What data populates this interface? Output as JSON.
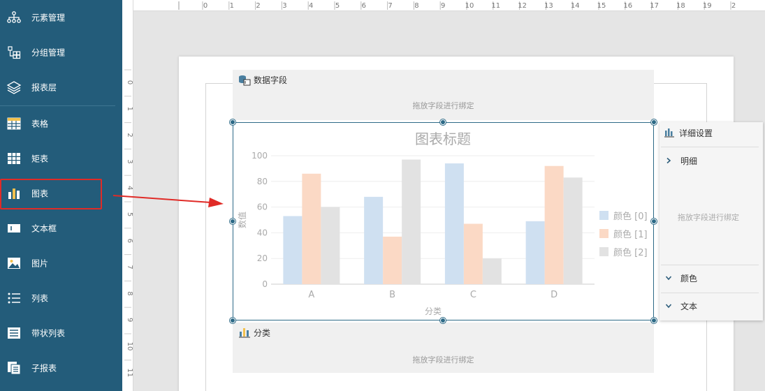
{
  "sidebar": {
    "items": [
      {
        "label": "元素管理",
        "icon": "hierarchy-icon"
      },
      {
        "label": "分组管理",
        "icon": "group-icon"
      },
      {
        "label": "报表层",
        "icon": "layers-icon"
      },
      {
        "label": "表格",
        "icon": "table-icon"
      },
      {
        "label": "矩表",
        "icon": "matrix-icon"
      },
      {
        "label": "图表",
        "icon": "chart-icon"
      },
      {
        "label": "文本框",
        "icon": "textbox-icon"
      },
      {
        "label": "图片",
        "icon": "image-icon"
      },
      {
        "label": "列表",
        "icon": "list-icon"
      },
      {
        "label": "带状列表",
        "icon": "banded-list-icon"
      },
      {
        "label": "子报表",
        "icon": "subreport-icon"
      }
    ],
    "highlighted": "图表",
    "highlight_color": "#e02b27"
  },
  "ruler": {
    "horizontal_labels": [
      "0",
      "1",
      "2",
      "3",
      "4",
      "5",
      "6",
      "7",
      "8",
      "9",
      "10",
      "11",
      "12",
      "13",
      "14",
      "15",
      "16",
      "17",
      "18",
      "19",
      "2"
    ],
    "vertical_labels": [
      "0",
      "1",
      "2",
      "3",
      "4",
      "5",
      "6",
      "7",
      "8",
      "9",
      "10",
      "11"
    ]
  },
  "zones": {
    "data_field": {
      "title": "数据字段",
      "hint": "拖放字段进行绑定"
    },
    "category": {
      "title": "分类",
      "hint": "拖放字段进行绑定"
    }
  },
  "settings_panel": {
    "title": "详细设置",
    "detail_label": "明细",
    "drop_hint": "拖放字段进行绑定",
    "color_label": "颜色",
    "text_label": "文本"
  },
  "chart_data": {
    "type": "bar",
    "title": "图表标题",
    "xlabel": "分类",
    "ylabel": "数值",
    "categories": [
      "A",
      "B",
      "C",
      "D"
    ],
    "ylim": [
      0,
      100
    ],
    "yticks": [
      "0",
      "20",
      "40",
      "60",
      "80",
      "100"
    ],
    "legend_position": "right",
    "grid": true,
    "series": [
      {
        "name": "颜色 [0]",
        "values": [
          53,
          68,
          94,
          49
        ],
        "color": "#cfe0f1"
      },
      {
        "name": "颜色 [1]",
        "values": [
          86,
          37,
          47,
          92
        ],
        "color": "#fbd9c5"
      },
      {
        "name": "颜色 [2]",
        "values": [
          60,
          97,
          20,
          83
        ],
        "color": "#e2e2e2"
      }
    ]
  },
  "colors": {
    "sidebar_bg": "#235c7a",
    "selection": "#2d6a87",
    "arrow": "#e02b27"
  }
}
